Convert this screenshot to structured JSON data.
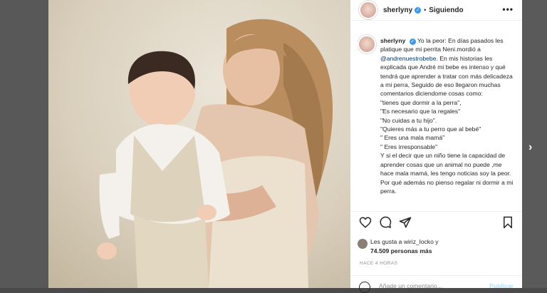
{
  "post": {
    "username": "sherlyny",
    "follow_status": "Siguiendo",
    "more_label": "•••",
    "verified_glyph": "✓"
  },
  "caption": {
    "username": "sherlyny",
    "intro": "Yo la peor: En días pasados les platique que mi perrita Neni.mordió a ",
    "mention": "@andrenuestrobebe",
    "body": ". En mis historias les explicada que André mi bebe es intenso y qué tendrá que aprender a tratar con más delicadeza a mi perra, Seguido de eso llegaron muchas comentarios diciendome cosas como:\n\"tienes que dormir a la perra\",\n\"Es necesario que la regales\"\n\"No cuidas a tu hijo\".\n\"Quieres más a tu perro que al bebé\"\n\" Eres una mala mamá\"\n\" Eres irresponsable\"\nY si el decir que un niño tiene la capacidad de aprender cosas que un animal no puede ,me hace mala mamá, les tengo noticias soy la peor. Por qué además no pienso regalar ni dormir a mi perra."
  },
  "likes": {
    "line1": "Les gusta a wiriz_locko y",
    "line2": "74.509 personas más"
  },
  "time_ago": "HACE 4 HORAS",
  "comment": {
    "placeholder": "Añade un comentario...",
    "publish": "Publicar"
  },
  "icons": {
    "more": "more-options-icon",
    "like": "heart-icon",
    "comment": "comment-icon",
    "share": "share-icon",
    "save": "bookmark-icon",
    "next": "chevron-right-icon",
    "verified": "verified-badge-icon",
    "emoji": "emoji-icon"
  },
  "colors": {
    "verified": "#3897f0",
    "mention": "#00376b",
    "publish_disabled": "#b2dffc"
  }
}
